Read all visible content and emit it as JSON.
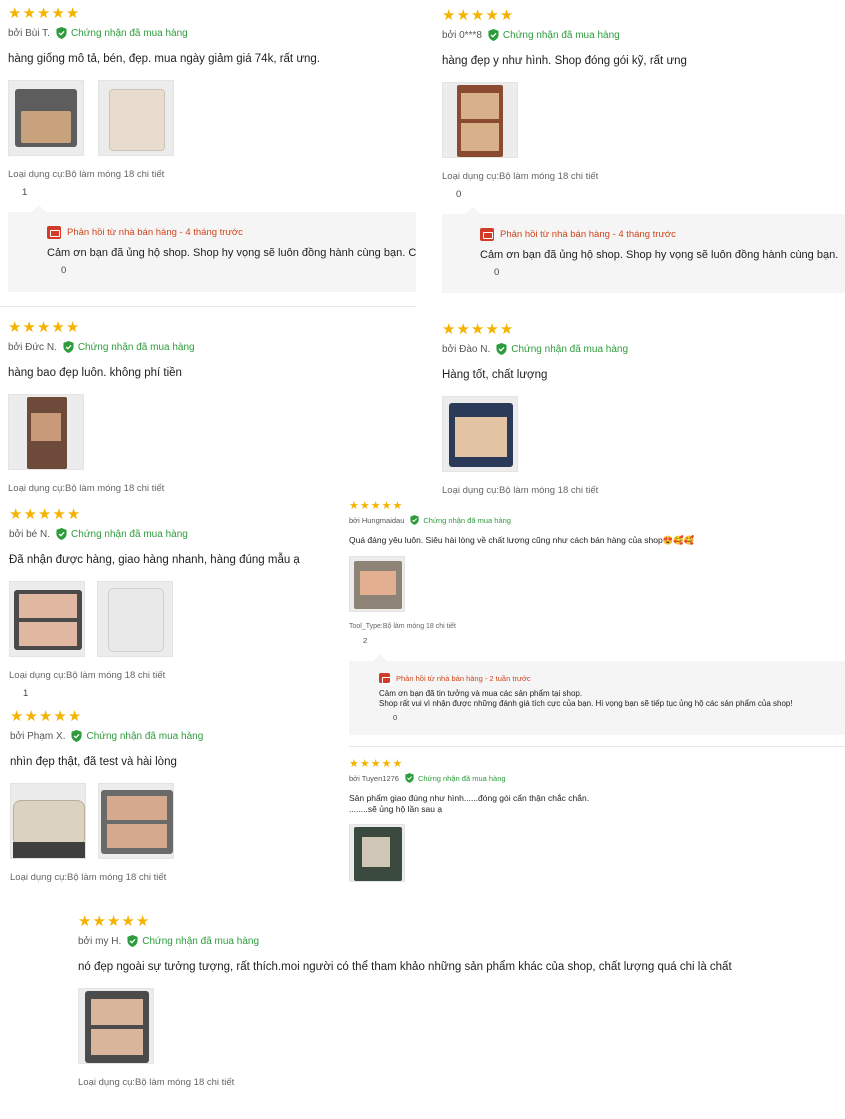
{
  "star_char": "★",
  "verified_label": "Chứng nhận đã mua hàng",
  "colors": {
    "star": "#f5b301",
    "verified": "#2e9c3c",
    "reply_head": "#d0451b",
    "reply_bg": "#f5f5f5"
  },
  "reviews": [
    {
      "author": "bởi Bùi T.",
      "text": "hàng giống mô tả, bén, đẹp. mua ngày giảm giá 74k, rất ưng.",
      "variant": "Loại dụng cụ:Bộ làm móng 18 chi tiết",
      "likes": "1",
      "reply": {
        "head": "Phản hồi từ nhà bán hàng - 4 tháng trước",
        "text": "Cảm ơn bạn đã ủng hộ shop. Shop hy vọng sẽ luôn đồng hành cùng bạn. C",
        "likes": "0"
      }
    },
    {
      "author": "bởi 0***8",
      "text": "hàng đẹp y như hình. Shop đóng gói kỹ, rất ưng",
      "variant": "Loại dụng cụ:Bộ làm móng 18 chi tiết",
      "likes": "0",
      "reply": {
        "head": "Phản hồi từ nhà bán hàng - 4 tháng trước",
        "text": "Cảm ơn bạn đã ủng hộ shop. Shop hy vọng sẽ luôn đồng hành cùng bạn.",
        "likes": "0"
      }
    },
    {
      "author": "bởi Đức N.",
      "text": "hàng bao đẹp luôn. không phí tiền",
      "variant": "Loại dụng cụ:Bộ làm móng 18 chi tiết"
    },
    {
      "author": "bởi Đào N.",
      "text": "Hàng tốt, chất lượng",
      "variant": "Loại dụng cụ:Bộ làm móng 18 chi tiết"
    },
    {
      "author": "bởi bé N.",
      "text": "Đã nhận được hàng, giao hàng nhanh, hàng đúng mẫu ạ",
      "variant": "Loại dụng cụ:Bộ làm móng 18 chi tiết",
      "likes": "1"
    },
    {
      "author": "bởi Hungmaidau",
      "text": "Quá đáng yêu luôn. Siêu hài lòng về chất lượng cũng như cách bán hàng của shop😍🥰🥰",
      "variant": "Tool_Type:Bộ làm móng 18 chi tiết",
      "likes": "2",
      "reply": {
        "head": "Phản hồi từ nhà bán hàng - 2 tuần trước",
        "text": "Cảm ơn bạn đã tin tưởng và mua các sản phẩm tại shop.",
        "text2": "Shop rất vui vì nhận được những đánh giá tích cực của bạn. Hi vọng bạn sẽ tiếp tục ủng hộ các sản phẩm của shop!",
        "likes": "0"
      }
    },
    {
      "author": "bởi Phạm X.",
      "text": "nhìn đẹp thật, đã test và hài lòng",
      "variant": "Loại dụng cụ:Bộ làm móng 18 chi tiết"
    },
    {
      "author": "bởi Tuyen1276",
      "text": "Sản phẩm giao đúng như hình......đóng gói cẩn thận chắc chắn.",
      "text2": "........sẽ ủng hộ lần sau ạ"
    },
    {
      "author": "bởi my H.",
      "text": "nó đẹp ngoài sự tưởng tượng, rất thích.moi người có thể tham khảo những sản phẩm khác của shop, chất lượng quá chi là chất",
      "variant": "Loại dụng cụ:Bộ làm móng 18 chi tiết"
    }
  ]
}
